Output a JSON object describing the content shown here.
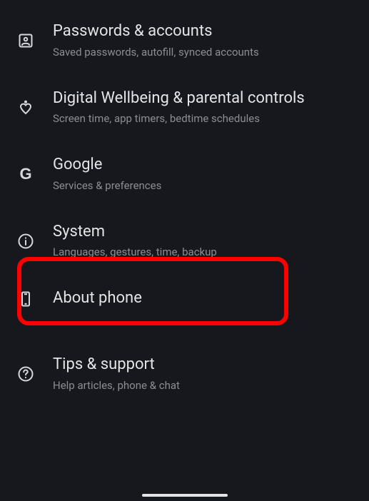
{
  "items": [
    {
      "id": "passwords",
      "title": "Passwords & accounts",
      "subtitle": "Saved passwords, autofill, synced accounts"
    },
    {
      "id": "wellbeing",
      "title": "Digital Wellbeing & parental controls",
      "subtitle": "Screen time, app timers, bedtime schedules"
    },
    {
      "id": "google",
      "title": "Google",
      "subtitle": "Services & preferences"
    },
    {
      "id": "system",
      "title": "System",
      "subtitle": "Languages, gestures, time, backup"
    },
    {
      "id": "about",
      "title": "About phone",
      "subtitle": ""
    },
    {
      "id": "tips",
      "title": "Tips & support",
      "subtitle": "Help articles, phone & chat"
    }
  ],
  "highlighted_index": 3
}
